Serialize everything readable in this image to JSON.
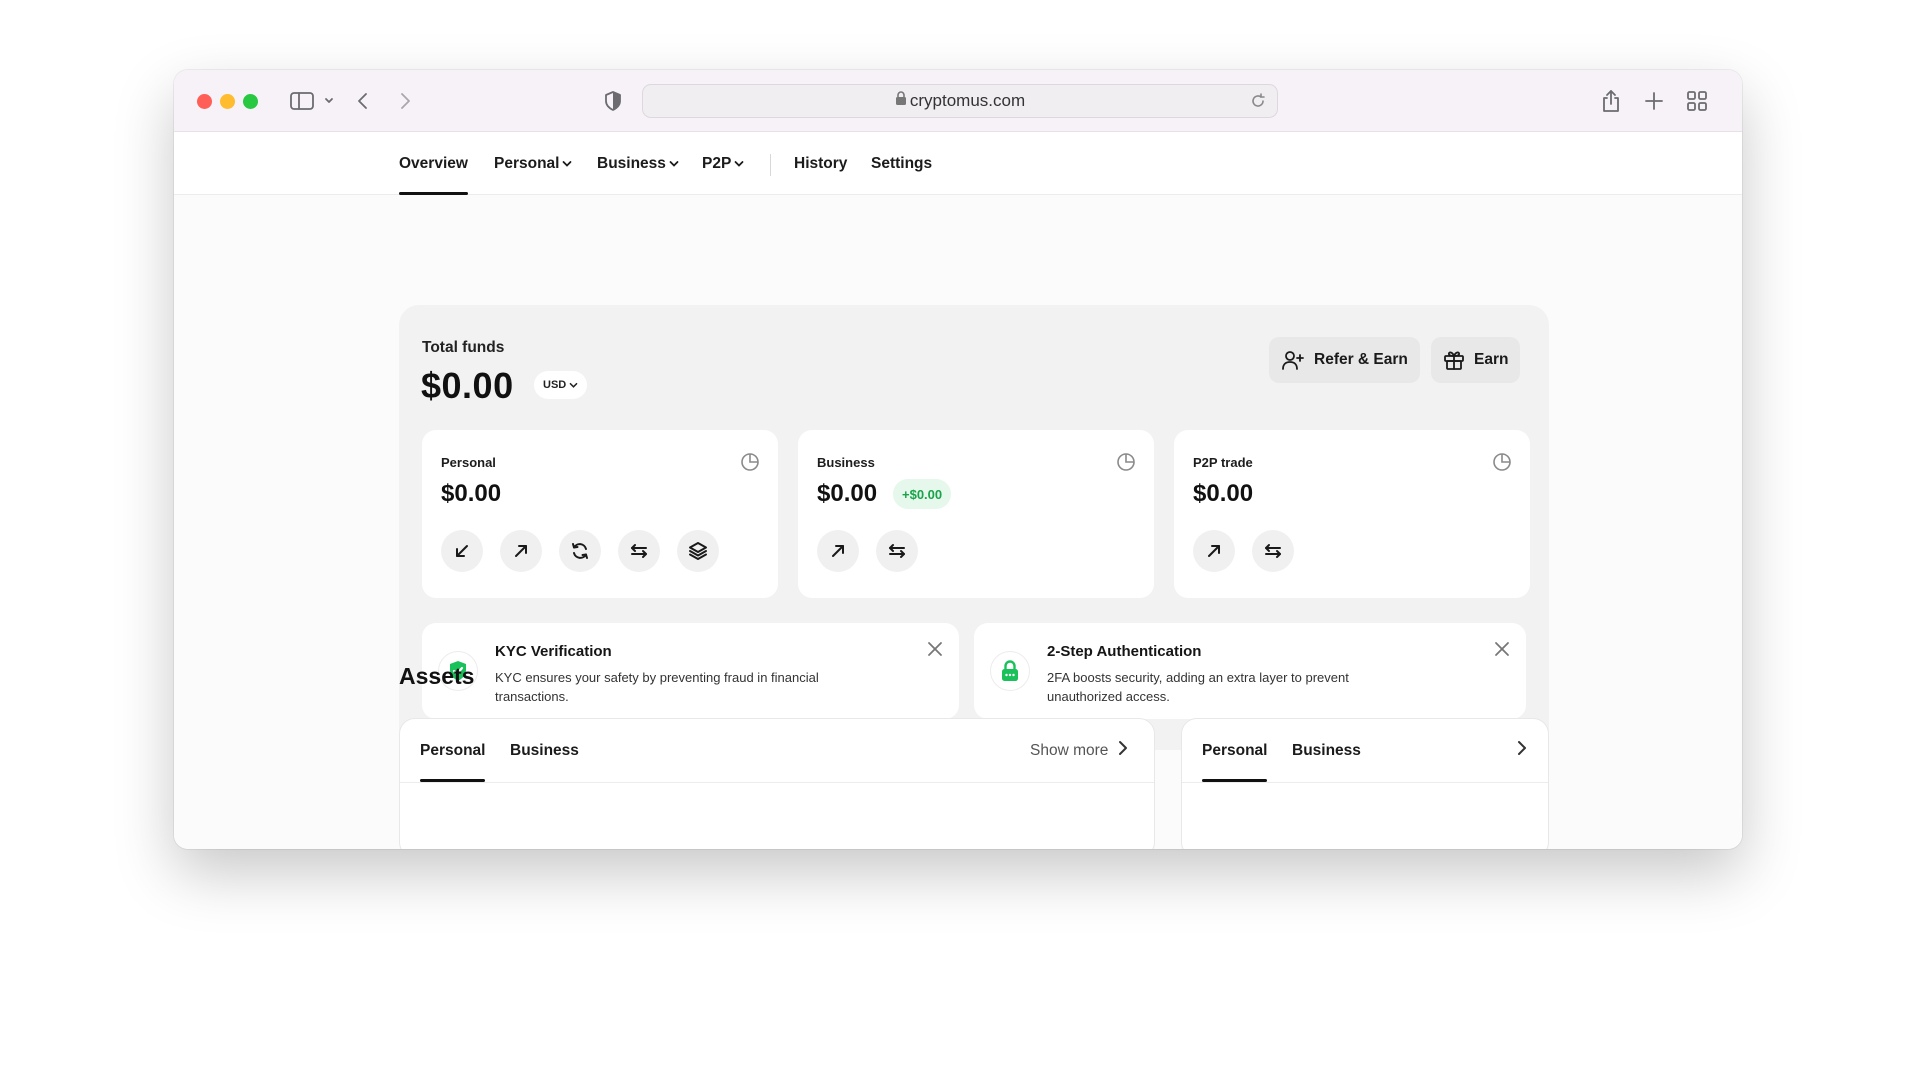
{
  "browser": {
    "url": "cryptomus.com"
  },
  "nav": {
    "items": [
      {
        "label": "Overview",
        "active": true,
        "dropdown": false
      },
      {
        "label": "Personal",
        "active": false,
        "dropdown": true
      },
      {
        "label": "Business",
        "active": false,
        "dropdown": true
      },
      {
        "label": "P2P",
        "active": false,
        "dropdown": true
      },
      {
        "label": "History",
        "active": false,
        "dropdown": false
      },
      {
        "label": "Settings",
        "active": false,
        "dropdown": false
      }
    ]
  },
  "funds": {
    "label": "Total funds",
    "amount": "$0.00",
    "currency": "USD",
    "refer_label": "Refer & Earn",
    "earn_label": "Earn"
  },
  "wallets": [
    {
      "name": "Personal",
      "amount": "$0.00",
      "actions": [
        "arrow-down-left-icon",
        "arrow-up-right-icon",
        "refresh-icon",
        "swap-icon",
        "layers-icon"
      ]
    },
    {
      "name": "Business",
      "amount": "$0.00",
      "delta": "+$0.00",
      "actions": [
        "arrow-up-right-icon",
        "swap-icon"
      ]
    },
    {
      "name": "P2P trade",
      "amount": "$0.00",
      "actions": [
        "arrow-up-right-icon",
        "swap-icon"
      ]
    }
  ],
  "notices": [
    {
      "title": "KYC Verification",
      "line1": "KYC ensures your safety by preventing fraud in financial",
      "line2": "transactions.",
      "icon": "shield-check-icon",
      "color": "#19c15a"
    },
    {
      "title": "2-Step Authentication",
      "line1": "2FA boosts security, adding an extra layer to prevent",
      "line2": "unauthorized access.",
      "icon": "lock-icon",
      "color": "#19c15a"
    }
  ],
  "assets": {
    "title": "Assets",
    "left_tabs": [
      "Personal",
      "Business"
    ],
    "show_more": "Show more",
    "right_tabs": [
      "Personal",
      "Business"
    ]
  },
  "colors": {
    "accent_green": "#19a34a",
    "badge_bg": "#e6f7ec"
  }
}
